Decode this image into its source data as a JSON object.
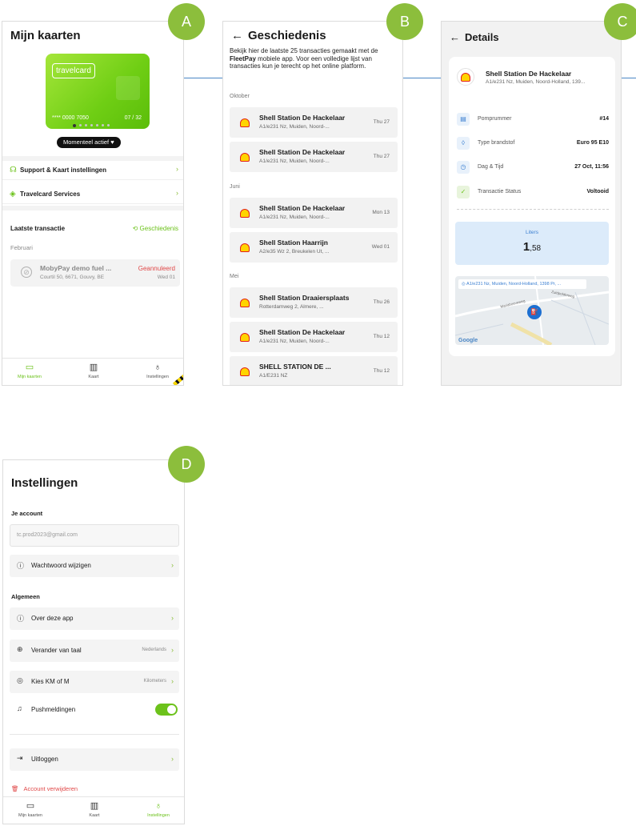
{
  "badges": {
    "a": "A",
    "b": "B",
    "c": "C",
    "d": "D"
  },
  "panel_a": {
    "title": "Mijn kaarten",
    "card": {
      "logo": "travelcard",
      "number": "**** 0000 7050",
      "expiry": "07 / 32"
    },
    "status_pill": "Momenteel actief",
    "menu": [
      {
        "label": "Support & Kaart instellingen",
        "icon": "headset-icon"
      },
      {
        "label": "Travelcard Services",
        "icon": "shield-icon"
      }
    ],
    "last_tx_title": "Laatste transactie",
    "history_link": "Geschiedenis",
    "month": "Februari",
    "transaction": {
      "name": "MobyPay demo fuel ...",
      "address": "Courtil 50, 6671, Gouvy, BE",
      "status": "Geannuleerd",
      "date": "Wed 01"
    },
    "nav": [
      "Mijn kaarten",
      "Kaart",
      "Instellingen"
    ]
  },
  "panel_b": {
    "title": "Geschiedenis",
    "intro_before": "Bekijk hier de laatste 25 transacties gemaakt met de ",
    "intro_bold": "FleetPay",
    "intro_after": " mobiele app. Voor een volledige lijst van transacties kun je terecht op het online platform.",
    "groups": [
      {
        "month": "Oktober",
        "items": [
          {
            "name": "Shell Station De Hackelaar",
            "address": "A1/e231 Nz, Muiden, Noord-...",
            "date": "Thu 27"
          },
          {
            "name": "Shell Station De Hackelaar",
            "address": "A1/e231 Nz, Muiden, Noord-...",
            "date": "Thu 27"
          }
        ]
      },
      {
        "month": "Juni",
        "items": [
          {
            "name": "Shell Station De Hackelaar",
            "address": "A1/e231 Nz, Muiden, Noord-...",
            "date": "Mon 13"
          },
          {
            "name": "Shell Station Haarrijn",
            "address": "A2/e35 Wz 2, Breukelen Ut, ...",
            "date": "Wed 01"
          }
        ]
      },
      {
        "month": "Mei",
        "items": [
          {
            "name": "Shell Station Draaiersplaats",
            "address": "Rotterdamweg 2, Almere, ...",
            "date": "Thu 26"
          },
          {
            "name": "Shell Station De Hackelaar",
            "address": "A1/e231 Nz, Muiden, Noord-...",
            "date": "Thu 12"
          },
          {
            "name": "SHELL STATION DE ...",
            "address": "A1/E231 NZ",
            "date": "Thu 12"
          }
        ]
      }
    ]
  },
  "panel_c": {
    "title": "Details",
    "station_name": "Shell Station De Hackelaar",
    "station_address": "A1/e231 Nz, Muiden, Noord-Holland, 139...",
    "rows": [
      {
        "label": "Pomprummer",
        "value": "#14",
        "icon": "receipt-icon"
      },
      {
        "label": "Type brandstof",
        "value": "Euro 95 E10",
        "icon": "droplet-icon"
      },
      {
        "label": "Dag & Tijd",
        "value": "27 Oct, 11:56",
        "icon": "clock-icon"
      },
      {
        "label": "Transactie Status",
        "value": "Voltooid",
        "icon": "check-icon"
      }
    ],
    "liters_label": "Liters",
    "liters_int": "1",
    "liters_dec": ",58",
    "map_address": "A1/e231 Nz, Muiden, Noord-Holland, 1398 Pr, ...",
    "map_roads": [
      "Mariahoeveweg",
      "Zuidpolderweg"
    ],
    "map_logo": "Google"
  },
  "panel_d": {
    "title": "Instellingen",
    "account_section": "Je account",
    "email": "tc.prod2023@gmail.com",
    "change_password": "Wachtwoord wijzigen",
    "general_section": "Algemeen",
    "rows": [
      {
        "label": "Over deze app",
        "value": "",
        "icon": "info-icon"
      },
      {
        "label": "Verander van taal",
        "value": "Nederlands",
        "icon": "globe-icon"
      },
      {
        "label": "Kies KM of M",
        "value": "Kilometers",
        "icon": "location-icon"
      }
    ],
    "push_label": "Pushmeldingen",
    "push_enabled": true,
    "logout": "Uitloggen",
    "delete_account": "Account verwijderen",
    "nav": [
      "Mijn kaarten",
      "Kaart",
      "Instellingen"
    ]
  },
  "colors": {
    "accent": "#6cc21b",
    "badge": "#8cbe3c",
    "danger": "#e04848",
    "link": "#3b7fd1"
  }
}
